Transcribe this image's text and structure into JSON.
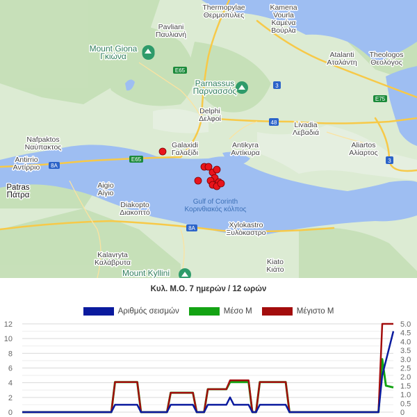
{
  "map": {
    "places": [
      {
        "id": "thermopylae",
        "text": "Thermopylae\nΘερμοπύλες"
      },
      {
        "id": "kamena",
        "text": "Kamena\nVourla\nΚαμένα\nΒούρλα"
      },
      {
        "id": "pavliani",
        "text": "Pavliani\nΠαυλιανή"
      },
      {
        "id": "mount-giona",
        "text": "Mount Giona\nΓκιώνα"
      },
      {
        "id": "atalanti",
        "text": "Atalanti\nΑταλάντη"
      },
      {
        "id": "theologos",
        "text": "Theologos\nΘεολόγος"
      },
      {
        "id": "parnassus",
        "text": "Parnassus\nΠαρνασσός"
      },
      {
        "id": "delphi",
        "text": "Delphi\nΔελφοί"
      },
      {
        "id": "livadia",
        "text": "Livadia\nΛεβαδιά"
      },
      {
        "id": "nafpaktos",
        "text": "Nafpaktos\nΝαύπακτος"
      },
      {
        "id": "galaxidi",
        "text": "Galaxidi\nΓαλαξίδι"
      },
      {
        "id": "antikyra",
        "text": "Antikyra\nΑντίκυρα"
      },
      {
        "id": "aliartos",
        "text": "Aliartos\nΑλίαρτος"
      },
      {
        "id": "antirrio",
        "text": "Antirrio\nΑντίρριο"
      },
      {
        "id": "patras",
        "text": "Patras\nΠάτρα"
      },
      {
        "id": "aigio",
        "text": "Aigio\nΑίγιο"
      },
      {
        "id": "diakopto",
        "text": "Diakopto\nΔιακοπτό"
      },
      {
        "id": "gulf",
        "text": "Gulf of Corinth\nΚορινθιακός κόλπος"
      },
      {
        "id": "xylokastro",
        "text": "Xylokastro\nΞυλόκαστρο"
      },
      {
        "id": "kalavryta",
        "text": "Kalavryta\nΚαλάβρυτα"
      },
      {
        "id": "kiato",
        "text": "Kiato\nΚιάτο"
      },
      {
        "id": "mount-kyllini",
        "text": "Mount Kyllini"
      }
    ],
    "road_shields": [
      "E65",
      "3",
      "E75",
      "48",
      "E65",
      "8A",
      "3",
      "8A"
    ],
    "quake_color": "#e8141c",
    "quakes": [
      [
        0.39,
        0.545
      ],
      [
        0.49,
        0.6
      ],
      [
        0.5,
        0.6
      ],
      [
        0.51,
        0.62
      ],
      [
        0.52,
        0.61
      ],
      [
        0.515,
        0.64
      ],
      [
        0.505,
        0.65
      ],
      [
        0.525,
        0.655
      ],
      [
        0.51,
        0.665
      ],
      [
        0.52,
        0.67
      ],
      [
        0.475,
        0.65
      ],
      [
        0.53,
        0.66
      ]
    ]
  },
  "chart": {
    "title": "Κυλ. Μ.Ο. 7 ημερών / 12 ωρών",
    "legend": [
      {
        "label": "Αριθμός σεισμών",
        "color": "#0a1a9e"
      },
      {
        "label": "Μέσο Μ",
        "color": "#13a313"
      },
      {
        "label": "Μέγιστο Μ",
        "color": "#a30d0d"
      }
    ]
  },
  "chart_data": {
    "type": "line",
    "title": "Κυλ. Μ.Ο. 7 ημερών / 12 ωρών",
    "x_count": 100,
    "y_left": {
      "min": 0,
      "max": 12,
      "ticks": [
        0,
        2,
        4,
        6,
        8,
        10,
        12
      ]
    },
    "y_right": {
      "min": 0,
      "max": 5,
      "ticks": [
        "0",
        "0.5",
        "1.0",
        "1.5",
        "2.0",
        "2.5",
        "3.0",
        "3.5",
        "4.0",
        "4.5",
        "5.0"
      ]
    },
    "series": [
      {
        "name": "Αριθμός σεισμών",
        "axis": "left",
        "color": "#0a1a9e",
        "segments": [
          [
            0,
            0
          ],
          [
            24,
            0
          ],
          [
            25,
            1
          ],
          [
            31,
            1
          ],
          [
            32,
            0
          ],
          [
            39,
            0
          ],
          [
            40,
            1
          ],
          [
            46,
            1
          ],
          [
            47,
            0
          ],
          [
            49,
            0
          ],
          [
            50,
            1
          ],
          [
            55,
            1
          ],
          [
            56,
            2
          ],
          [
            57,
            1
          ],
          [
            61,
            1
          ],
          [
            62,
            0
          ],
          [
            63,
            0
          ],
          [
            64,
            1
          ],
          [
            71,
            1
          ],
          [
            72,
            0
          ],
          [
            96,
            0
          ],
          [
            97,
            5
          ],
          [
            100,
            11
          ]
        ]
      },
      {
        "name": "Μέσο Μ",
        "axis": "right",
        "color": "#13a313",
        "segments": [
          [
            0,
            0
          ],
          [
            24,
            0
          ],
          [
            25,
            1.7
          ],
          [
            31,
            1.7
          ],
          [
            32,
            0
          ],
          [
            39,
            0
          ],
          [
            40,
            1.1
          ],
          [
            46,
            1.1
          ],
          [
            47,
            0
          ],
          [
            49,
            0
          ],
          [
            50,
            1.3
          ],
          [
            55,
            1.3
          ],
          [
            56,
            1.7
          ],
          [
            61,
            1.7
          ],
          [
            62,
            0
          ],
          [
            63,
            0
          ],
          [
            64,
            1.7
          ],
          [
            71,
            1.7
          ],
          [
            72,
            0
          ],
          [
            96,
            0
          ],
          [
            97,
            3.0
          ],
          [
            98,
            1.5
          ],
          [
            100,
            1.4
          ]
        ]
      },
      {
        "name": "Μέγιστο Μ",
        "axis": "right",
        "color": "#a30d0d",
        "segments": [
          [
            0,
            0
          ],
          [
            24,
            0
          ],
          [
            25,
            1.7
          ],
          [
            31,
            1.7
          ],
          [
            32,
            0
          ],
          [
            39,
            0
          ],
          [
            40,
            1.1
          ],
          [
            46,
            1.1
          ],
          [
            47,
            0
          ],
          [
            49,
            0
          ],
          [
            50,
            1.3
          ],
          [
            55,
            1.3
          ],
          [
            56,
            1.8
          ],
          [
            61,
            1.8
          ],
          [
            62,
            0
          ],
          [
            63,
            0
          ],
          [
            64,
            1.7
          ],
          [
            71,
            1.7
          ],
          [
            72,
            0
          ],
          [
            96,
            0
          ],
          [
            97,
            5.0
          ],
          [
            100,
            5.0
          ]
        ]
      }
    ]
  }
}
